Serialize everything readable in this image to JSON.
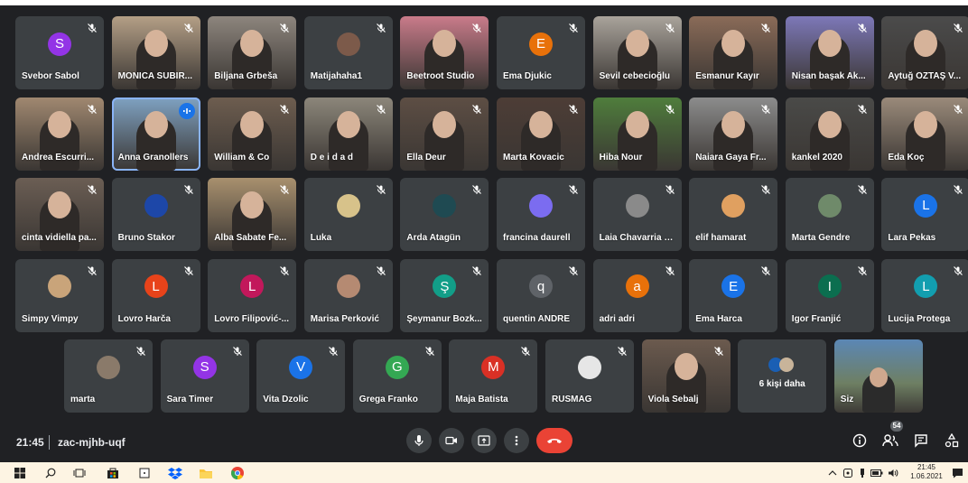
{
  "colors": {
    "accent": "#1a73e8",
    "end_call": "#ea4335",
    "tile_bg": "#3c4043",
    "page_bg": "#202124",
    "taskbar_bg": "#fdf4e3"
  },
  "participants": [
    {
      "name": "Svebor Sabol",
      "type": "avatar",
      "initial": "S",
      "color": "#9334e6"
    },
    {
      "name": "MONICA SUBIR...",
      "type": "video",
      "color": "#b49f86"
    },
    {
      "name": "Biljana Grbeša",
      "type": "video",
      "color": "#8d857d"
    },
    {
      "name": "Matijahaha1",
      "type": "image",
      "color": "#7c5a4a"
    },
    {
      "name": "Beetroot Studio",
      "type": "video",
      "color": "#c97b8a"
    },
    {
      "name": "Ema Djukic",
      "type": "avatar",
      "initial": "E",
      "color": "#e8710a"
    },
    {
      "name": "Sevil cebecioğlu",
      "type": "video",
      "color": "#a9a39b"
    },
    {
      "name": "Esmanur Kayır",
      "type": "video",
      "color": "#8a6b58"
    },
    {
      "name": "Nisan başak Ak...",
      "type": "video",
      "color": "#7d78b8"
    },
    {
      "name": "Aytuğ ÖZTAŞ V...",
      "type": "video",
      "color": "#4b4b4b"
    },
    {
      "name": "Andrea Escurri...",
      "type": "video",
      "color": "#a08870"
    },
    {
      "name": "Anna Granollers",
      "type": "video",
      "color": "#7fa2c2",
      "speaking": true
    },
    {
      "name": "William & Co",
      "type": "video",
      "color": "#6d5d4f"
    },
    {
      "name": "D e i d a d",
      "type": "video",
      "color": "#8c867a"
    },
    {
      "name": "Ella Deur",
      "type": "video",
      "color": "#5d4e44"
    },
    {
      "name": "Marta Kovacic",
      "type": "video",
      "color": "#4d3d36"
    },
    {
      "name": "Hiba Nour",
      "type": "video",
      "color": "#4f7d3c"
    },
    {
      "name": "Naiara Gaya Fr...",
      "type": "video",
      "color": "#8c8c8c"
    },
    {
      "name": "kankel 2020",
      "type": "video",
      "color": "#4a4a48"
    },
    {
      "name": "Eda Koç",
      "type": "video",
      "color": "#9a8a7a"
    },
    {
      "name": "cinta vidiella pa...",
      "type": "video",
      "color": "#6b5e54"
    },
    {
      "name": "Bruno Stakor",
      "type": "image",
      "color": "#1d47a8"
    },
    {
      "name": "Alba Sabate Fe...",
      "type": "video",
      "color": "#a8906e"
    },
    {
      "name": "Luka",
      "type": "image",
      "color": "#d7c28a"
    },
    {
      "name": "Arda Atagün",
      "type": "image",
      "color": "#1f4a52"
    },
    {
      "name": "francina daurell",
      "type": "image",
      "color": "#7b6cf0"
    },
    {
      "name": "Laia Chavarria F...",
      "type": "image",
      "color": "#8a8a8a"
    },
    {
      "name": "elif hamarat",
      "type": "image",
      "color": "#e0a060"
    },
    {
      "name": "Marta Gendre",
      "type": "image",
      "color": "#6f8a6a"
    },
    {
      "name": "Lara Pekas",
      "type": "avatar",
      "initial": "L",
      "color": "#1a73e8"
    },
    {
      "name": "Simpy Vimpy",
      "type": "image",
      "color": "#c9a47a"
    },
    {
      "name": "Lovro Harča",
      "type": "avatar",
      "initial": "L",
      "color": "#e8431a"
    },
    {
      "name": "Lovro Filipović-...",
      "type": "avatar",
      "initial": "L",
      "color": "#c2185b"
    },
    {
      "name": "Marisa Perković",
      "type": "image",
      "color": "#b58a72"
    },
    {
      "name": "Şeymanur Bozk...",
      "type": "avatar",
      "initial": "Ş",
      "color": "#129e88"
    },
    {
      "name": "quentin ANDRE",
      "type": "avatar",
      "initial": "q",
      "color": "#5f6368"
    },
    {
      "name": "adri adri",
      "type": "avatar",
      "initial": "a",
      "color": "#e8710a"
    },
    {
      "name": "Ema Harca",
      "type": "avatar",
      "initial": "E",
      "color": "#1a73e8"
    },
    {
      "name": "Igor Franjić",
      "type": "avatar",
      "initial": "I",
      "color": "#0b6e4f"
    },
    {
      "name": "Lucija Protega",
      "type": "avatar",
      "initial": "L",
      "color": "#129eaf"
    },
    {
      "name": "marta",
      "type": "image",
      "color": "#8a7a6a"
    },
    {
      "name": "Sara Timer",
      "type": "avatar",
      "initial": "S",
      "color": "#9334e6"
    },
    {
      "name": "Vita Dzolic",
      "type": "avatar",
      "initial": "V",
      "color": "#1a73e8"
    },
    {
      "name": "Grega Franko",
      "type": "avatar",
      "initial": "G",
      "color": "#34a853"
    },
    {
      "name": "Maja Batista",
      "type": "avatar",
      "initial": "M",
      "color": "#d93025"
    },
    {
      "name": "RUSMAG",
      "type": "image",
      "color": "#e6e6e6"
    },
    {
      "name": "Viola Sebalj",
      "type": "video",
      "color": "#6b5a4e"
    }
  ],
  "more_tile": {
    "label": "6 kişi daha"
  },
  "self_tile": {
    "label": "Siz"
  },
  "meeting": {
    "time": "21:45",
    "code": "zac-mjhb-uqf"
  },
  "people_count": "54",
  "taskbar": {
    "time": "21:45",
    "date": "1.06.2021",
    "search_icon": "search-icon",
    "start_icon": "windows-icon"
  }
}
